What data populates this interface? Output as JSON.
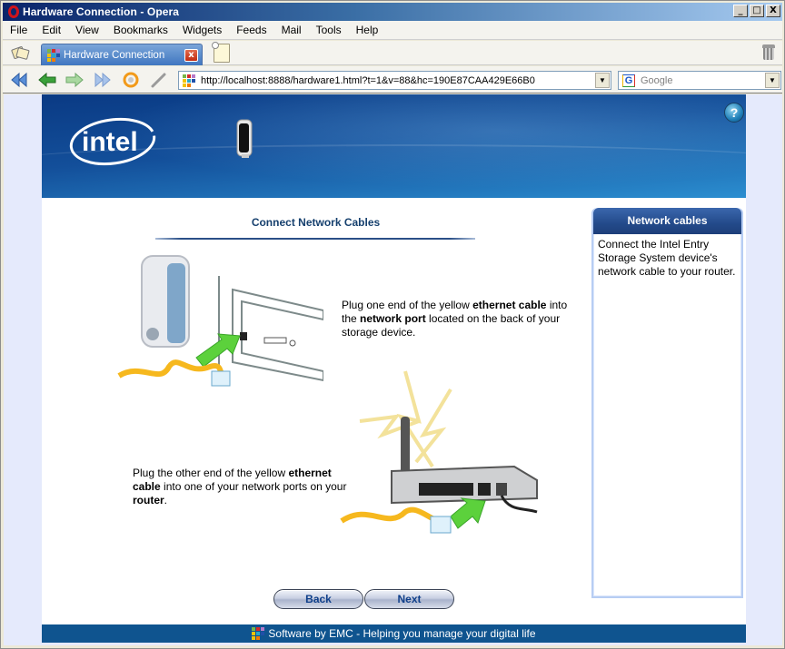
{
  "window": {
    "title": "Hardware Connection - Opera",
    "controls": {
      "minimize": "_",
      "maximize": "□",
      "close": "X"
    }
  },
  "menubar": {
    "items": [
      "File",
      "Edit",
      "View",
      "Bookmarks",
      "Widgets",
      "Feeds",
      "Mail",
      "Tools",
      "Help"
    ]
  },
  "tabs": [
    {
      "label": "Hardware Connection",
      "active": true,
      "close": "x"
    }
  ],
  "navbar": {
    "address": "http://localhost:8888/hardware1.html?t=1&v=88&hc=190E87CAA429E66B0",
    "search_engine": "G",
    "search_placeholder": "Google",
    "dropdown_glyph": "▼"
  },
  "page": {
    "help_label": "?",
    "heading": "Connect Network Cables",
    "step1": {
      "parts": [
        {
          "text": "Plug one end of the yellow ",
          "bold": false
        },
        {
          "text": "ethernet cable",
          "bold": true
        },
        {
          "text": " into the ",
          "bold": false
        },
        {
          "text": "network port",
          "bold": true
        },
        {
          "text": " located on the back of your storage device.",
          "bold": false
        }
      ]
    },
    "step2": {
      "parts": [
        {
          "text": "Plug the other end of the yellow ",
          "bold": false
        },
        {
          "text": "ethernet cable",
          "bold": true
        },
        {
          "text": " into one of your network ports on your ",
          "bold": false
        },
        {
          "text": "router",
          "bold": true
        },
        {
          "text": ".",
          "bold": false
        }
      ]
    },
    "buttons": {
      "back": "Back",
      "next": "Next"
    },
    "footer": "Software by EMC - Helping you manage your digital life",
    "side_panel": {
      "title": "Network cables",
      "body": "Connect the Intel Entry Storage System device's network cable to your router."
    }
  },
  "colors": {
    "banner_dark": "#0a3a84",
    "heading_text": "#16406e",
    "footer_bg": "#0f548f",
    "panel_head": "#234a8a",
    "arrow_green": "#5cd13c",
    "cable_yellow": "#f6b81e"
  }
}
